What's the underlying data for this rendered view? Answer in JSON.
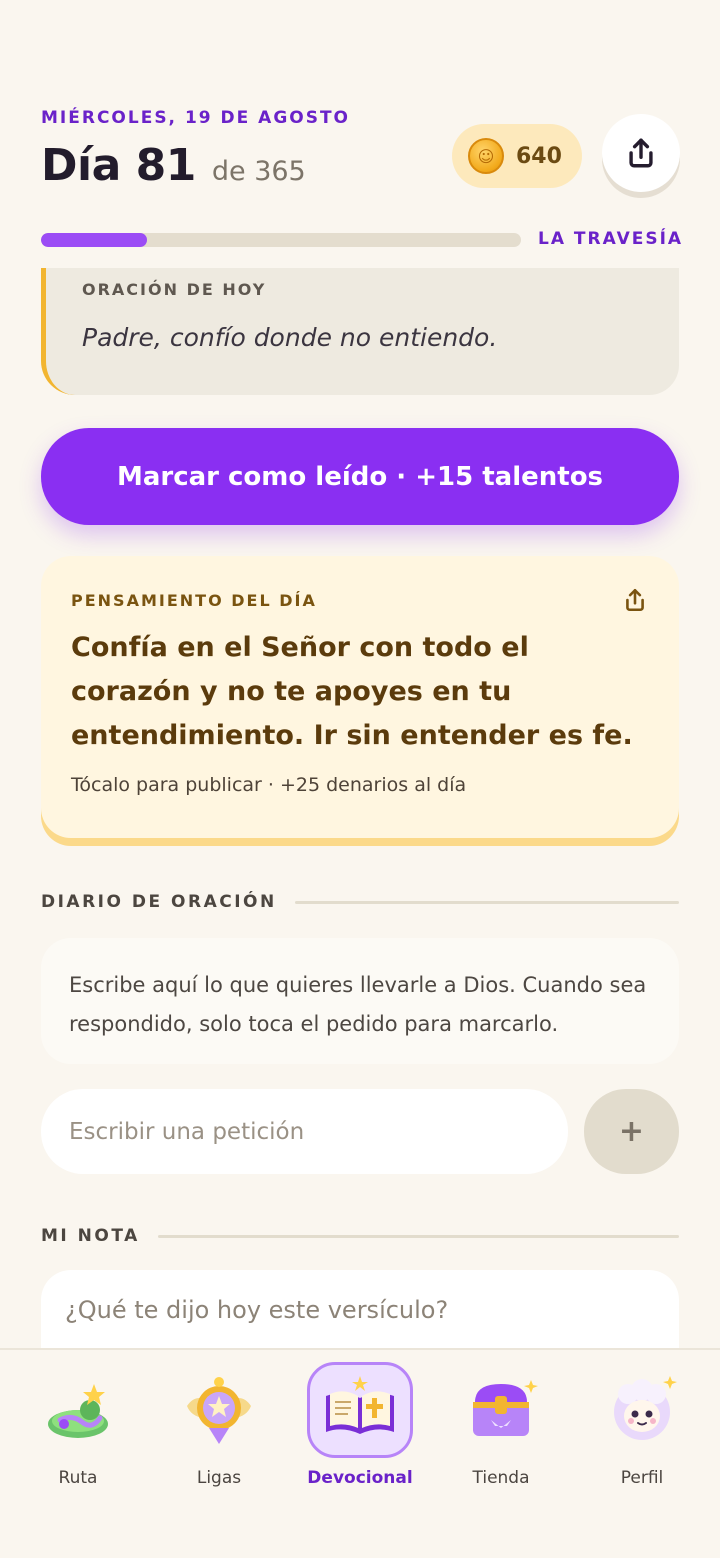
{
  "header": {
    "date": "MIÉRCOLES, 19 DE AGOSTO",
    "day_title": "Día 81",
    "day_of": "de 365",
    "coins": "640",
    "share_icon": "share-icon",
    "progress_fraction": 0.22,
    "journey_label": "LA TRAVESÍA"
  },
  "prayer": {
    "label": "ORACIÓN DE HOY",
    "text": "Padre, confío donde no entiendo."
  },
  "cta": {
    "label": "Marcar como leído · +15 talentos"
  },
  "thought": {
    "label": "PENSAMIENTO DEL DÍA",
    "text": "Confía en el Señor con todo el corazón y no te apoyes en tu entendimiento. Ir sin entender es fe.",
    "hint": "Tócalo para publicar · +25 denarios al día"
  },
  "journal": {
    "title": "DIARIO DE ORACIÓN",
    "info": "Escribe aquí lo que quieres llevarle a Dios. Cuando sea respondido, solo toca el pedido para marcarlo.",
    "input_placeholder": "Escribir una petición",
    "add_label": "+"
  },
  "note": {
    "title": "MI NOTA",
    "placeholder": "¿Qué te dijo hoy este versículo?"
  },
  "nav": {
    "items": [
      {
        "label": "Ruta",
        "icon": "map-island-icon"
      },
      {
        "label": "Ligas",
        "icon": "medal-icon"
      },
      {
        "label": "Devocional",
        "icon": "open-bible-icon",
        "active": true
      },
      {
        "label": "Tienda",
        "icon": "treasure-chest-icon"
      },
      {
        "label": "Perfil",
        "icon": "lamb-avatar-icon"
      }
    ]
  },
  "colors": {
    "accent": "#8a2ff2",
    "accent_dark": "#6a22c9",
    "background": "#faf6ef",
    "coin_pill": "#fde9bc",
    "thought_bg": "#fff6e0"
  }
}
